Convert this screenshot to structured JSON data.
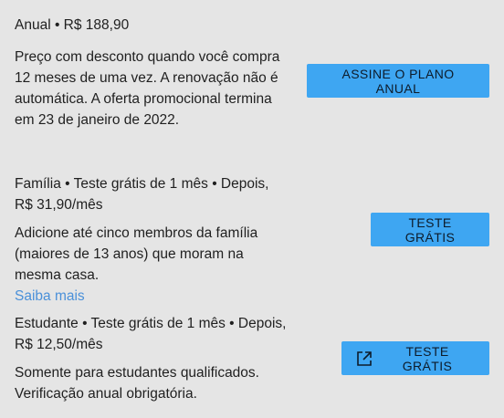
{
  "plans": {
    "annual": {
      "header": "Anual • R$ 188,90",
      "description": "Preço com desconto quando você compra 12 meses de uma vez. A renovação não é automática. A oferta promocional termina em 23 de janeiro de 2022.",
      "button_label": "ASSINE O PLANO ANUAL"
    },
    "family": {
      "header": "Família • Teste grátis de 1 mês • Depois, R$ 31,90/mês",
      "description": "Adicione até cinco membros da família (maiores de 13 anos) que moram na mesma casa.",
      "link_label": "Saiba mais",
      "button_label": "TESTE GRÁTIS"
    },
    "student": {
      "header": "Estudante • Teste grátis de 1 mês • Depois, R$ 12,50/mês",
      "description": "Somente para estudantes qualificados. Verificação anual obrigatória.",
      "button_label": "TESTE GRÁTIS",
      "button_icon": "external-link-icon"
    }
  },
  "colors": {
    "background": "#e5e5e5",
    "button": "#3ea6f2",
    "link": "#4a90d9"
  }
}
